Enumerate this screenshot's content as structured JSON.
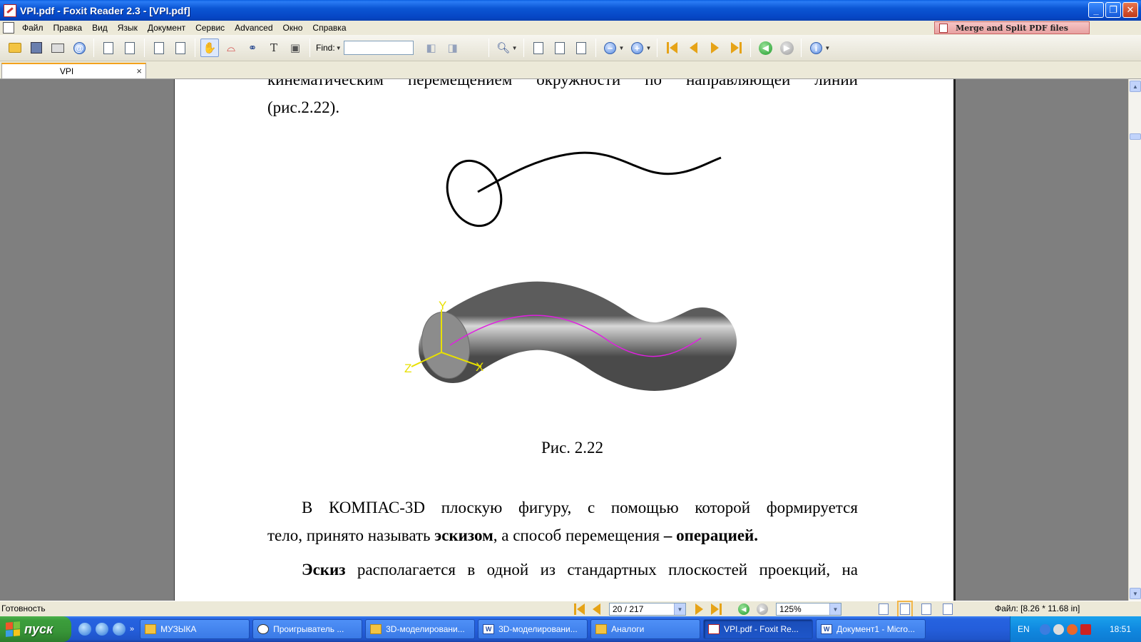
{
  "window": {
    "title": "VPI.pdf - Foxit Reader 2.3 - [VPI.pdf]",
    "minimize_icon": "minimize-icon",
    "restore_icon": "restore-icon",
    "close_icon": "close-icon"
  },
  "menu": {
    "items": [
      "Файл",
      "Правка",
      "Вид",
      "Язык",
      "Документ",
      "Сервис",
      "Advanced",
      "Окно",
      "Справка"
    ],
    "banner": "Merge and Split PDF files"
  },
  "toolbar": {
    "find_label": "Find:",
    "find_value": ""
  },
  "tabs": [
    {
      "label": "VPI"
    }
  ],
  "document": {
    "line_top_words": [
      "кинематическим",
      "перемещением",
      "окружности",
      "по",
      "направляющей",
      "линии"
    ],
    "line_fig_ref": "(рис.2.22).",
    "figure_caption": "Рис. 2.22",
    "axis_labels": {
      "y": "Y",
      "z": "Z",
      "x": "X"
    },
    "para1_line1_words": [
      "В",
      "КОМПАС-3D",
      "плоскую",
      "фигуру,",
      "с",
      "помощью",
      "которой",
      "формируется"
    ],
    "para1_line2_a": "тело, принято называть ",
    "para1_line2_b": "эскизом",
    "para1_line2_c": ", а способ перемещения ",
    "para1_line2_d": "– операцией.",
    "para2_line1_bold": "Эскиз",
    "para2_line1_words": [
      "располагается",
      "в",
      "одной",
      "из",
      "стандартных",
      "плоскостей",
      "проекций,",
      "на"
    ]
  },
  "statusbar": {
    "status": "Готовность",
    "page_indicator": "20 / 217",
    "zoom": "125%",
    "file_info": "Файл: [8.26 * 11.68 in]"
  },
  "taskbar": {
    "start": "пуск",
    "buttons": [
      {
        "label": "МУЗЫКА",
        "icon": "folder-icon"
      },
      {
        "label": "Проигрыватель ...",
        "icon": "media-player-icon"
      },
      {
        "label": "3D-моделировани...",
        "icon": "folder-icon"
      },
      {
        "label": "3D-моделировани...",
        "icon": "word-icon"
      },
      {
        "label": "Аналоги",
        "icon": "folder-icon"
      },
      {
        "label": "VPI.pdf - Foxit Re...",
        "icon": "foxit-icon"
      },
      {
        "label": "Документ1 - Micro...",
        "icon": "word-icon"
      }
    ],
    "language": "EN",
    "clock": "18:51"
  },
  "colors": {
    "titlebar": "#0b56d4",
    "guide_curve": "#e020e0",
    "axes": "#e8e000",
    "page_bg": "#ffffff",
    "viewer_bg": "#7f7f7f"
  }
}
